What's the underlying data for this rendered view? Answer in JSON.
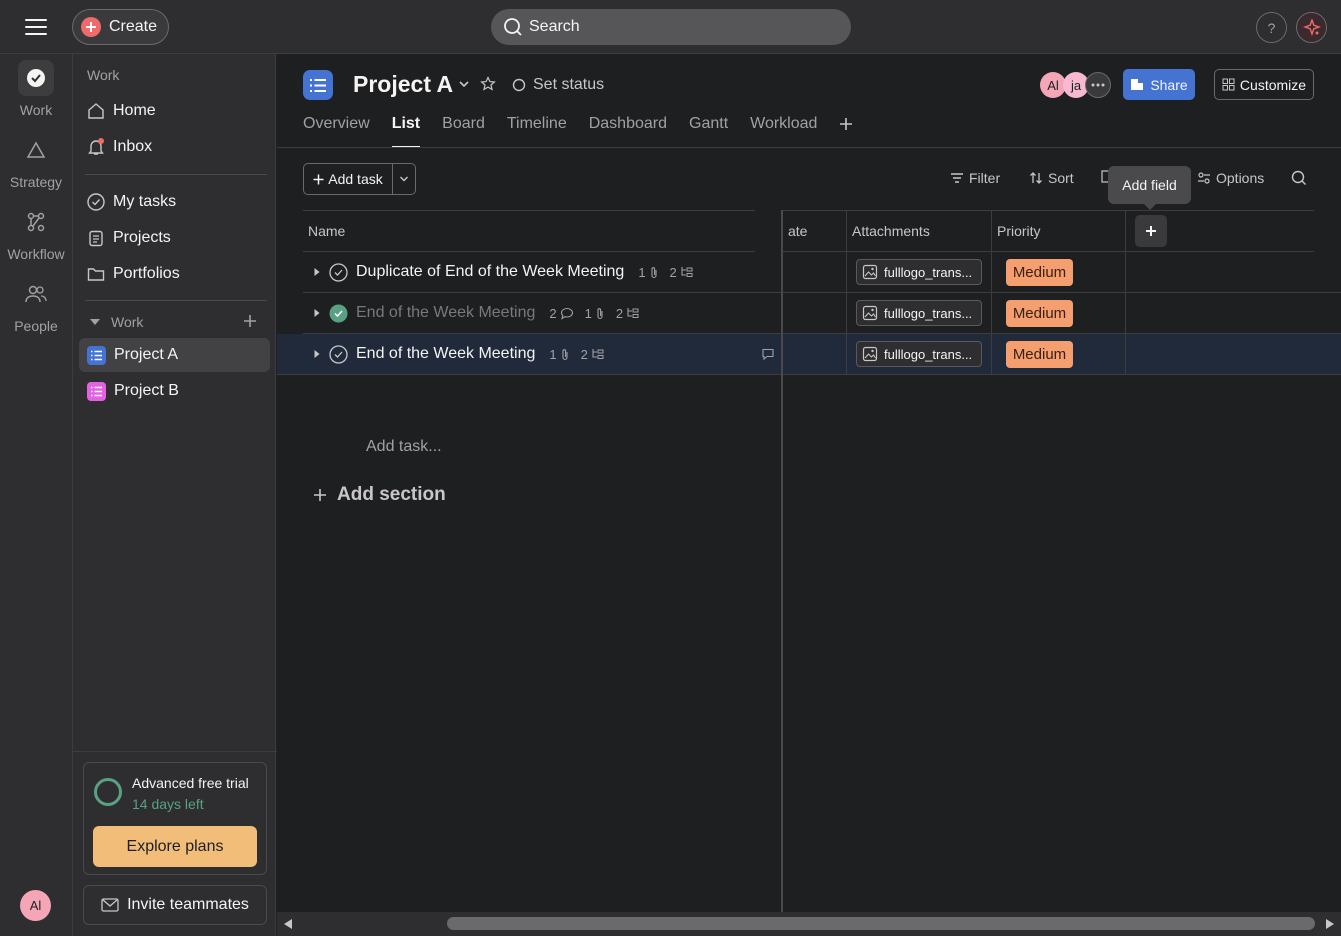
{
  "topbar": {
    "create_label": "Create",
    "search_placeholder": "Search",
    "help_label": "?"
  },
  "rail": {
    "items": [
      {
        "label": "Work",
        "icon": "check-circle-icon"
      },
      {
        "label": "Strategy",
        "icon": "triangle-icon"
      },
      {
        "label": "Workflow",
        "icon": "workflow-icon"
      },
      {
        "label": "People",
        "icon": "people-icon"
      }
    ],
    "user_initials": "Al"
  },
  "sidebar": {
    "section_work": "Work",
    "home": "Home",
    "inbox": "Inbox",
    "my_tasks": "My tasks",
    "projects": "Projects",
    "portfolios": "Portfolios",
    "group_label": "Work",
    "project_a": "Project A",
    "project_b": "Project B",
    "trial_title": "Advanced free trial",
    "trial_days": "14 days left",
    "explore_label": "Explore plans",
    "invite_label": "Invite teammates"
  },
  "header": {
    "title": "Project A",
    "set_status": "Set status",
    "avatars": [
      "Al",
      "ja"
    ],
    "share_label": "Share",
    "customize_label": "Customize",
    "tabs": [
      "Overview",
      "List",
      "Board",
      "Timeline",
      "Dashboard",
      "Gantt",
      "Workload"
    ],
    "active_tab": "List"
  },
  "toolbar": {
    "add_task": "Add task",
    "filter": "Filter",
    "sort": "Sort",
    "options": "Options",
    "tooltip": "Add field"
  },
  "table": {
    "columns": {
      "name": "Name",
      "date": "ate",
      "attachments": "Attachments",
      "priority": "Priority"
    },
    "rows": [
      {
        "name": "Duplicate of End of the Week Meeting",
        "comments": "",
        "attachments": "1",
        "subtasks": "2",
        "completed": false,
        "attachment_file": "fulllogo_trans...",
        "priority": "Medium"
      },
      {
        "name": "End of the Week Meeting",
        "comments": "2",
        "attachments": "1",
        "subtasks": "2",
        "completed": true,
        "attachment_file": "fulllogo_trans...",
        "priority": "Medium"
      },
      {
        "name": "End of the Week Meeting",
        "comments": "",
        "attachments": "1",
        "subtasks": "2",
        "completed": false,
        "attachment_file": "fulllogo_trans...",
        "priority": "Medium"
      }
    ],
    "add_task_placeholder": "Add task...",
    "add_section": "Add section"
  },
  "colors": {
    "accent": "#4573d2",
    "priority_medium": "#f59e70",
    "complete": "#58a182",
    "create": "#f06a6a",
    "trial": "#f1bd79"
  }
}
